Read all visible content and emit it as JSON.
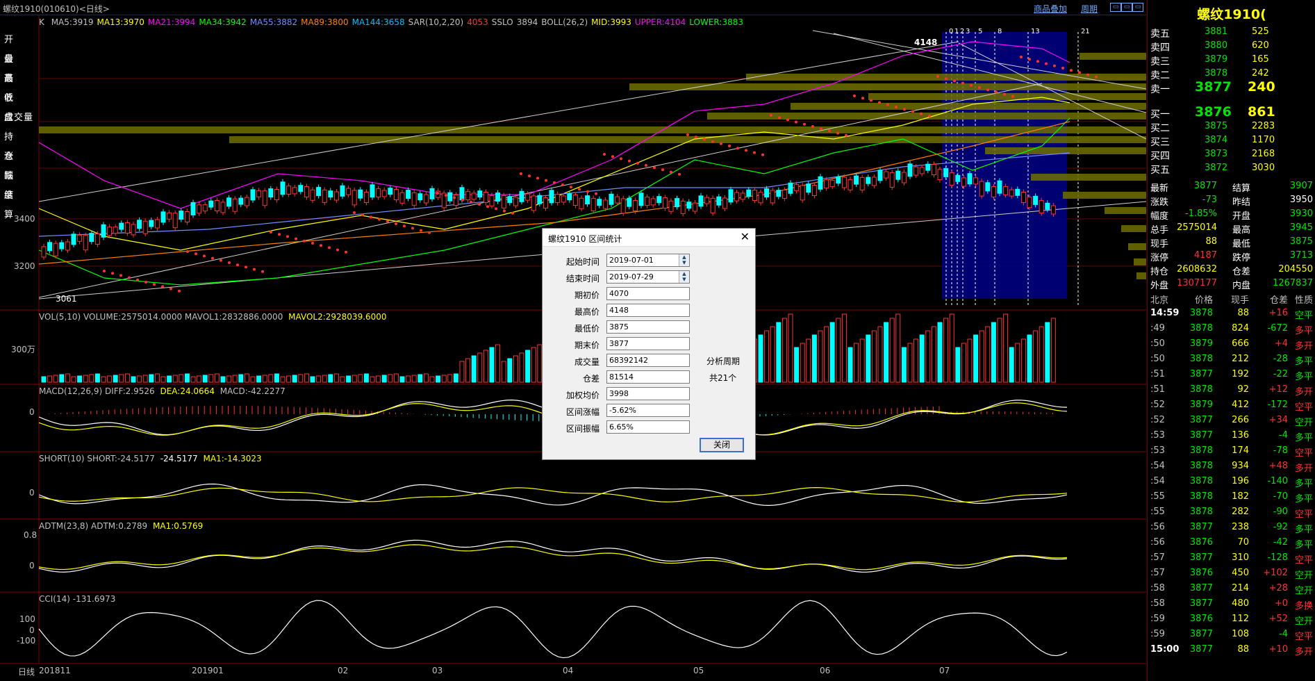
{
  "window": {
    "title": "螺纹1910(010610)<日线>",
    "links": [
      "商品叠加",
      "周期"
    ]
  },
  "left_labels": [
    "开盘",
    "最高",
    "最低",
    "收盘",
    "成交量",
    "持仓",
    "涨跌",
    "幅度",
    "结算"
  ],
  "k_indicator": {
    "prefix": "K",
    "items": [
      {
        "t": "MA5:3919",
        "c": "#c0c0c0"
      },
      {
        "t": "MA13:3970",
        "c": "#ffff00"
      },
      {
        "t": "MA21:3994",
        "c": "#ff00ff"
      },
      {
        "t": "MA34:3942",
        "c": "#00ff00"
      },
      {
        "t": "MA55:3882",
        "c": "#6f8fff"
      },
      {
        "t": "MA89:3800",
        "c": "#ff8000"
      },
      {
        "t": "MA144:3658",
        "c": "#00bfff"
      },
      {
        "t": "SAR(10,2,20)",
        "c": "#c0c0c0"
      },
      {
        "t": "4053",
        "c": "#ff3232"
      },
      {
        "t": "SSLO",
        "c": "#c0c0c0"
      },
      {
        "t": "3894",
        "c": "#c0c0c0"
      },
      {
        "t": "BOLL(26,2)",
        "c": "#c0c0c0"
      },
      {
        "t": "MID:3993",
        "c": "#ffff00"
      },
      {
        "t": "UPPER:4104",
        "c": "#ff00ff"
      },
      {
        "t": "LOWER:3883",
        "c": "#00ff00"
      }
    ]
  },
  "price_axis": {
    "labels": [
      "3400",
      "3200"
    ],
    "high_mark": "4148",
    "low_mark": "3061"
  },
  "period_marks": [
    "0",
    "1",
    "2",
    "3",
    "5",
    "8",
    "13",
    "21"
  ],
  "vol": {
    "title": "VOL(5,10) VOLUME:2575014.0000 MAVOL1:2832886.0000",
    "mavol2": "MAVOL2:2928039.6000",
    "axis": "300万"
  },
  "macd": {
    "title": "MACD(12,26,9) DIFF:2.9526",
    "dea": "DEA:24.0664",
    "macd": "MACD:-42.2277",
    "axis": "0"
  },
  "short": {
    "title": "SHORT(10) SHORT:-24.5177",
    "v2": "-24.5177",
    "ma1": "MA1:-14.3023",
    "axis": "0"
  },
  "adtm": {
    "title": "ADTM(23,8) ADTM:0.2789",
    "ma1": "MA1:0.5769",
    "axis_top": "0.8",
    "axis_zero": "0"
  },
  "cci": {
    "title": "CCI(14) -131.6973",
    "axis": [
      "100",
      "0",
      "-100"
    ]
  },
  "x_axis": {
    "label": "日线",
    "ticks": [
      "201811",
      "201901",
      "02",
      "03",
      "04",
      "05",
      "06",
      "07"
    ]
  },
  "right_panel": {
    "title": "螺纹1910(",
    "asks": [
      {
        "label": "卖五",
        "price": "3881",
        "vol": "525"
      },
      {
        "label": "卖四",
        "price": "3880",
        "vol": "620"
      },
      {
        "label": "卖三",
        "price": "3879",
        "vol": "165"
      },
      {
        "label": "卖二",
        "price": "3878",
        "vol": "242"
      },
      {
        "label": "卖一",
        "price": "3877",
        "vol": "240"
      }
    ],
    "bids": [
      {
        "label": "买一",
        "price": "3876",
        "vol": "861"
      },
      {
        "label": "买二",
        "price": "3875",
        "vol": "2283"
      },
      {
        "label": "买三",
        "price": "3874",
        "vol": "1170"
      },
      {
        "label": "买四",
        "price": "3873",
        "vol": "2168"
      },
      {
        "label": "买五",
        "price": "3872",
        "vol": "3030"
      }
    ],
    "quotes": [
      {
        "l1": "最新",
        "v1": "3877",
        "c1": "green",
        "l2": "结算",
        "v2": "3907",
        "c2": "green"
      },
      {
        "l1": "涨跌",
        "v1": "-73",
        "c1": "green",
        "l2": "昨结",
        "v2": "3950",
        "c2": "white"
      },
      {
        "l1": "幅度",
        "v1": "-1.85%",
        "c1": "green",
        "l2": "开盘",
        "v2": "3930",
        "c2": "green"
      },
      {
        "l1": "总手",
        "v1": "2575014",
        "c1": "yellow",
        "l2": "最高",
        "v2": "3945",
        "c2": "green"
      },
      {
        "l1": "现手",
        "v1": "88",
        "c1": "yellow",
        "l2": "最低",
        "v2": "3875",
        "c2": "green"
      },
      {
        "l1": "涨停",
        "v1": "4187",
        "c1": "red",
        "l2": "跌停",
        "v2": "3713",
        "c2": "green"
      },
      {
        "l1": "持仓",
        "v1": "2608632",
        "c1": "yellow",
        "l2": "仓差",
        "v2": "204550",
        "c2": "yellow"
      },
      {
        "l1": "外盘",
        "v1": "1307177",
        "c1": "red",
        "l2": "内盘",
        "v2": "1267837",
        "c2": "green"
      }
    ],
    "ticks_header": [
      "北京",
      "价格",
      "现手",
      "仓差",
      "性质"
    ],
    "ticks": [
      {
        "t": "14:59",
        "p": "3878",
        "v": "88",
        "d": "+16",
        "n": "空平",
        "pc": "green",
        "nc": "green"
      },
      {
        "t": ":49",
        "p": "3878",
        "v": "824",
        "d": "-672",
        "n": "多平",
        "pc": "green",
        "nc": "red"
      },
      {
        "t": ":50",
        "p": "3879",
        "v": "666",
        "d": "+4",
        "n": "多开",
        "pc": "green",
        "nc": "red"
      },
      {
        "t": ":50",
        "p": "3878",
        "v": "212",
        "d": "-28",
        "n": "多平",
        "pc": "green",
        "nc": "green"
      },
      {
        "t": ":51",
        "p": "3877",
        "v": "192",
        "d": "-22",
        "n": "多平",
        "pc": "green",
        "nc": "green"
      },
      {
        "t": ":51",
        "p": "3878",
        "v": "92",
        "d": "+12",
        "n": "多开",
        "pc": "green",
        "nc": "red"
      },
      {
        "t": ":52",
        "p": "3879",
        "v": "412",
        "d": "-172",
        "n": "空平",
        "pc": "green",
        "nc": "red"
      },
      {
        "t": ":52",
        "p": "3877",
        "v": "266",
        "d": "+34",
        "n": "空开",
        "pc": "green",
        "nc": "green"
      },
      {
        "t": ":53",
        "p": "3877",
        "v": "136",
        "d": "-4",
        "n": "多平",
        "pc": "green",
        "nc": "green"
      },
      {
        "t": ":53",
        "p": "3878",
        "v": "174",
        "d": "-78",
        "n": "空平",
        "pc": "green",
        "nc": "red"
      },
      {
        "t": ":54",
        "p": "3878",
        "v": "934",
        "d": "+48",
        "n": "多开",
        "pc": "green",
        "nc": "red"
      },
      {
        "t": ":54",
        "p": "3878",
        "v": "196",
        "d": "-140",
        "n": "多平",
        "pc": "green",
        "nc": "green"
      },
      {
        "t": ":55",
        "p": "3878",
        "v": "182",
        "d": "-70",
        "n": "多平",
        "pc": "green",
        "nc": "green"
      },
      {
        "t": ":55",
        "p": "3878",
        "v": "282",
        "d": "-90",
        "n": "空平",
        "pc": "green",
        "nc": "red"
      },
      {
        "t": ":56",
        "p": "3877",
        "v": "238",
        "d": "-92",
        "n": "多平",
        "pc": "green",
        "nc": "green"
      },
      {
        "t": ":56",
        "p": "3876",
        "v": "70",
        "d": "-42",
        "n": "多平",
        "pc": "green",
        "nc": "green"
      },
      {
        "t": ":57",
        "p": "3877",
        "v": "310",
        "d": "-128",
        "n": "空平",
        "pc": "green",
        "nc": "red"
      },
      {
        "t": ":57",
        "p": "3876",
        "v": "450",
        "d": "+102",
        "n": "空开",
        "pc": "green",
        "nc": "green"
      },
      {
        "t": ":58",
        "p": "3877",
        "v": "214",
        "d": "+28",
        "n": "空开",
        "pc": "green",
        "nc": "green"
      },
      {
        "t": ":58",
        "p": "3877",
        "v": "480",
        "d": "+0",
        "n": "多换",
        "pc": "green",
        "nc": "red"
      },
      {
        "t": ":59",
        "p": "3876",
        "v": "112",
        "d": "+52",
        "n": "空开",
        "pc": "green",
        "nc": "green"
      },
      {
        "t": ":59",
        "p": "3877",
        "v": "108",
        "d": "-4",
        "n": "空平",
        "pc": "green",
        "nc": "red"
      },
      {
        "t": "15:00",
        "p": "3877",
        "v": "88",
        "d": "+10",
        "n": "多开",
        "pc": "green",
        "nc": "red"
      }
    ]
  },
  "dialog": {
    "title": "螺纹1910 区间统计",
    "fields": [
      {
        "label": "起始时间",
        "value": "2019-07-01",
        "spin": true
      },
      {
        "label": "结束时间",
        "value": "2019-07-29",
        "spin": true
      },
      {
        "label": "期初价",
        "value": "4070"
      },
      {
        "label": "最高价",
        "value": "4148"
      },
      {
        "label": "最低价",
        "value": "3875"
      },
      {
        "label": "期末价",
        "value": "3877"
      },
      {
        "label": "成交量",
        "value": "68392142"
      },
      {
        "label": "仓差",
        "value": "81514"
      },
      {
        "label": "加权均价",
        "value": "3998"
      },
      {
        "label": "区间涨幅",
        "value": "-5.62%"
      },
      {
        "label": "区间振幅",
        "value": "6.65%"
      }
    ],
    "side_label": "分析周期",
    "side_count": "共21个",
    "close_button": "关闭"
  }
}
